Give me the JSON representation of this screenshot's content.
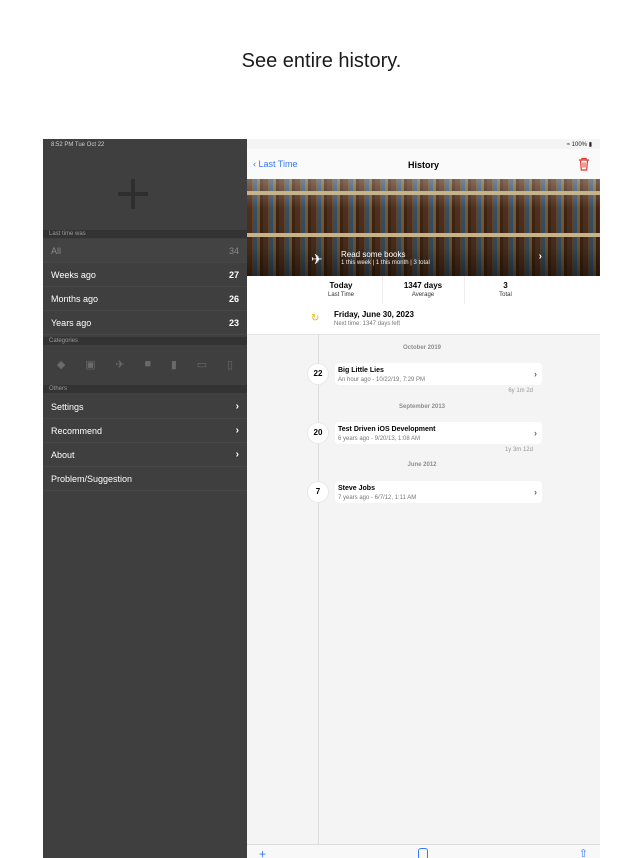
{
  "caption": "See entire history.",
  "status": {
    "time": "8:52 PM  Tue Oct 22",
    "battery": "100%"
  },
  "sidebar": {
    "section_last_time": "Last time was",
    "filters": [
      {
        "label": "All",
        "count": "34"
      },
      {
        "label": "Weeks ago",
        "count": "27"
      },
      {
        "label": "Months ago",
        "count": "26"
      },
      {
        "label": "Years ago",
        "count": "23"
      }
    ],
    "section_categories": "Categories",
    "section_others": "Others",
    "others": [
      {
        "label": "Settings"
      },
      {
        "label": "Recommend"
      },
      {
        "label": "About"
      },
      {
        "label": "Problem/Suggestion"
      }
    ]
  },
  "nav": {
    "back_label": "Last Time",
    "title": "History"
  },
  "hero": {
    "title": "Read some books",
    "subtitle": "1 this week | 1 this month | 3 total"
  },
  "stats": [
    {
      "value": "Today",
      "label": "Last Time"
    },
    {
      "value": "1347 days",
      "label": "Average"
    },
    {
      "value": "3",
      "label": "Total"
    }
  ],
  "next": {
    "date": "Friday, June 30, 2023",
    "sub": "Next time: 1347 days left"
  },
  "history": [
    {
      "month": "October 2019",
      "day": "22",
      "title": "Big Little Lies",
      "subtitle": "An hour ago - 10/22/19, 7:29 PM",
      "gap": "6y 1m 2d"
    },
    {
      "month": "September 2013",
      "day": "20",
      "title": "Test Driven iOS Development",
      "subtitle": "6 years ago - 9/20/13, 1:08 AM",
      "gap": "1y 3m 12d"
    },
    {
      "month": "June 2012",
      "day": "7",
      "title": "Steve Jobs",
      "subtitle": "7 years ago - 6/7/12, 1:11 AM",
      "gap": ""
    }
  ],
  "colors": {
    "accent": "#3478f6",
    "delete": "#e5352b",
    "sidebar_bg": "#3f3f3f"
  }
}
